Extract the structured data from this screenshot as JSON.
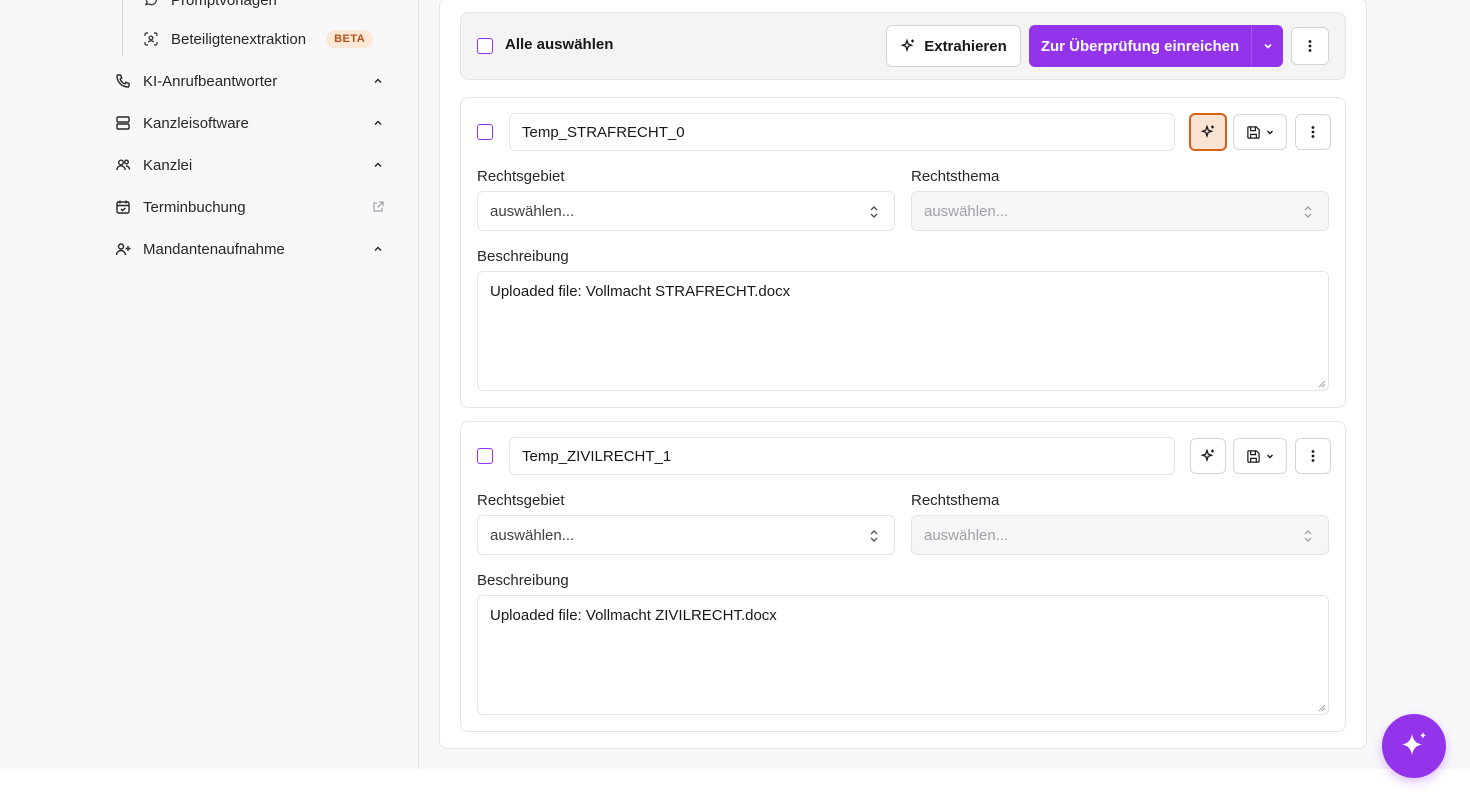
{
  "sidebar": {
    "partial_item": {
      "label": "Promptvorlagen",
      "icon": "chat-icon"
    },
    "sub_item": {
      "label": "Beteiligtenextraktion",
      "badge": "BETA",
      "icon": "scan-face-icon"
    },
    "items": [
      {
        "label": "KI-Anrufbeantworter",
        "icon": "phone-icon",
        "trailing": "chevron-up-icon"
      },
      {
        "label": "Kanzleisoftware",
        "icon": "server-icon",
        "trailing": "chevron-up-icon"
      },
      {
        "label": "Kanzlei",
        "icon": "users-icon",
        "trailing": "chevron-up-icon"
      },
      {
        "label": "Terminbuchung",
        "icon": "calendar-check-icon",
        "trailing": "external-link-icon"
      },
      {
        "label": "Mandantenaufnahme",
        "icon": "user-plus-icon",
        "trailing": "chevron-up-icon"
      }
    ]
  },
  "toolbar": {
    "select_all_label": "Alle auswählen",
    "extract_label": "Extrahieren",
    "submit_label": "Zur Überprüfung einreichen"
  },
  "documents": [
    {
      "name": "Temp_STRAFRECHT_0",
      "rechtsgebiet_label": "Rechtsgebiet",
      "rechtsgebiet_value": "auswählen...",
      "rechtsthema_label": "Rechtsthema",
      "rechtsthema_value": "auswählen...",
      "beschreibung_label": "Beschreibung",
      "beschreibung_value": "Uploaded file: Vollmacht STRAFRECHT.docx",
      "ai_button_active": true
    },
    {
      "name": "Temp_ZIVILRECHT_1",
      "rechtsgebiet_label": "Rechtsgebiet",
      "rechtsgebiet_value": "auswählen...",
      "rechtsthema_label": "Rechtsthema",
      "rechtsthema_value": "auswählen...",
      "beschreibung_label": "Beschreibung",
      "beschreibung_value": "Uploaded file: Vollmacht ZIVILRECHT.docx",
      "ai_button_active": false
    }
  ],
  "colors": {
    "primary": "#9333ea",
    "active_highlight": "#d9601a",
    "badge_bg": "#fde7d6",
    "badge_text": "#b4531a"
  }
}
